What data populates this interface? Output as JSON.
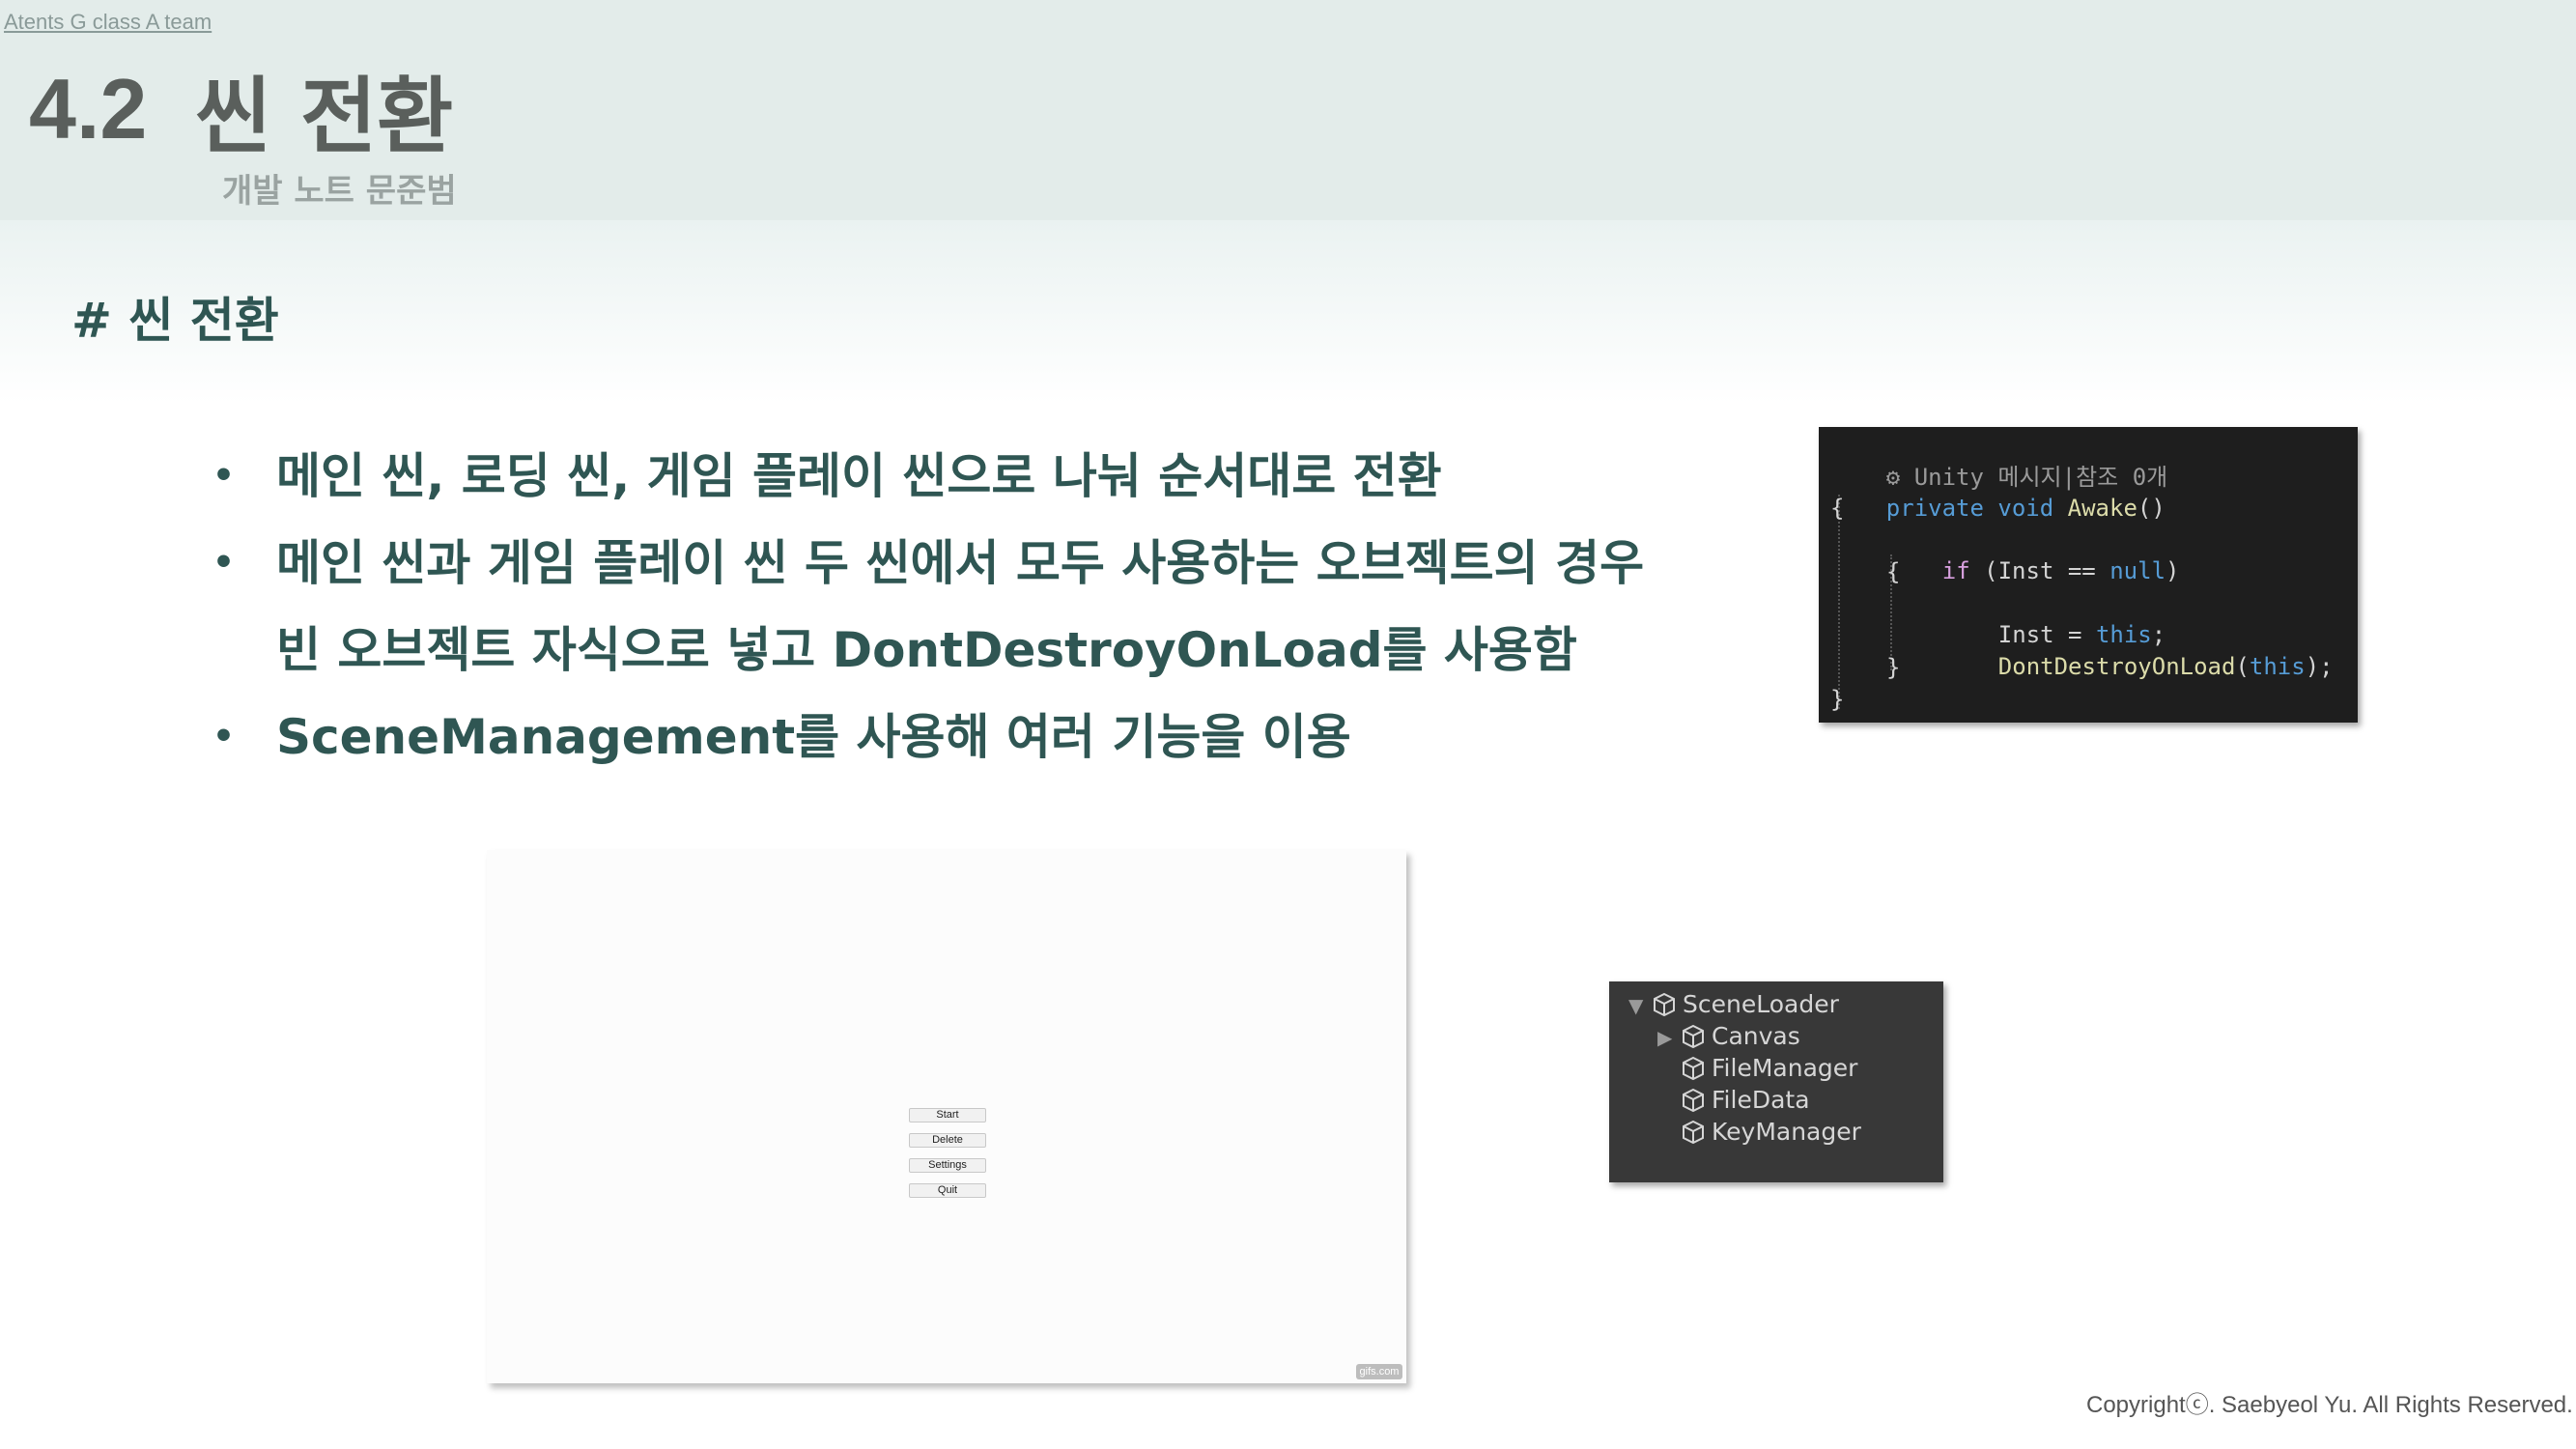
{
  "header": {
    "team_link": "Atents G class A team",
    "slide_number": "4.2",
    "slide_title": "씬 전환",
    "subtitle": "개발 노트 문준범"
  },
  "section": {
    "heading": "# 씬 전환"
  },
  "bullets": [
    {
      "marker": "•",
      "lines": [
        "메인 씬, 로딩 씬, 게임 플레이 씬으로 나눠 순서대로 전환"
      ]
    },
    {
      "marker": "•",
      "lines": [
        "메인 씬과 게임 플레이 씬 두 씬에서 모두 사용하는 오브젝트의 경우",
        "빈 오브젝트 자식으로 넣고 DontDestroyOnLoad를 사용함"
      ]
    },
    {
      "marker": "•",
      "lines": [
        "SceneManagement를 사용해 여러 기능을 이용"
      ]
    }
  ],
  "code_panel": {
    "meta": "Unity 메시지|참조 0개",
    "lines": {
      "l1_kw": "private void ",
      "l1_fn": "Awake",
      "l1_rest": "()",
      "l2": "{",
      "l3_if": "if",
      "l3_open": " (Inst ",
      "l3_op": "==",
      "l3_null": " null",
      "l3_close": ")",
      "l4": "{",
      "l5_var": "Inst = ",
      "l5_this": "this",
      "l5_end": ";",
      "l6_fn": "DontDestroyOnLoad",
      "l6_open": "(",
      "l6_this": "this",
      "l6_end": ");",
      "l7": "}",
      "l8": "}"
    }
  },
  "game_preview": {
    "buttons": [
      "Start",
      "Delete",
      "Settings",
      "Quit"
    ],
    "watermark": "gifs.com"
  },
  "hierarchy": {
    "items": [
      {
        "label": "SceneLoader",
        "arrow": "▼"
      },
      {
        "label": "Canvas",
        "arrow": "▶"
      },
      {
        "label": "FileManager",
        "arrow": ""
      },
      {
        "label": "FileData",
        "arrow": ""
      },
      {
        "label": "KeyManager",
        "arrow": ""
      }
    ],
    "icon": "cube-icon"
  },
  "footer": {
    "copyright": "Copyrightⓒ. Saebyeol Yu. All Rights Reserved."
  }
}
